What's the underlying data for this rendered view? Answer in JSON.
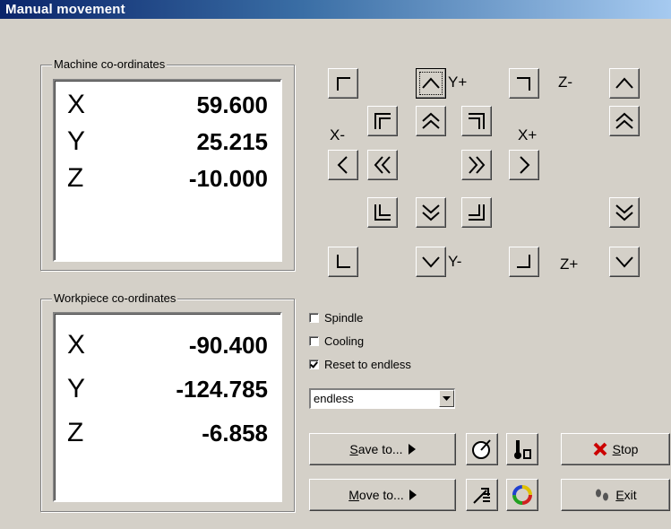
{
  "window": {
    "title": "Manual movement"
  },
  "machine": {
    "label": "Machine co-ordinates",
    "x_axis": "X",
    "y_axis": "Y",
    "z_axis": "Z",
    "x": "59.600",
    "y": "25.215",
    "z": "-10.000"
  },
  "workpiece": {
    "label": "Workpiece co-ordinates",
    "x_axis": "X",
    "y_axis": "Y",
    "z_axis": "Z",
    "x": "-90.400",
    "y": "-124.785",
    "z": "-6.858"
  },
  "jog": {
    "y_plus": "Y+",
    "y_minus": "Y-",
    "x_minus": "X-",
    "x_plus": "X+",
    "z_minus": "Z-",
    "z_plus": "Z+"
  },
  "options": {
    "spindle": {
      "label": "Spindle",
      "checked": false
    },
    "cooling": {
      "label": "Cooling",
      "checked": false
    },
    "reset": {
      "label": "Reset to endless",
      "checked": true
    }
  },
  "step_select": {
    "value": "endless"
  },
  "buttons": {
    "save_to_mnemonic": "S",
    "save_to_rest": "ave to...",
    "move_to_mnemonic": "M",
    "move_to_rest": "ove to...",
    "stop_mnemonic": "S",
    "stop_rest": "top",
    "exit_mnemonic": "E",
    "exit_rest": "xit"
  },
  "colors": {
    "title_start": "#0a246a",
    "title_end": "#a6caf0",
    "stop_red": "#cc0000",
    "face": "#d4d0c8"
  }
}
